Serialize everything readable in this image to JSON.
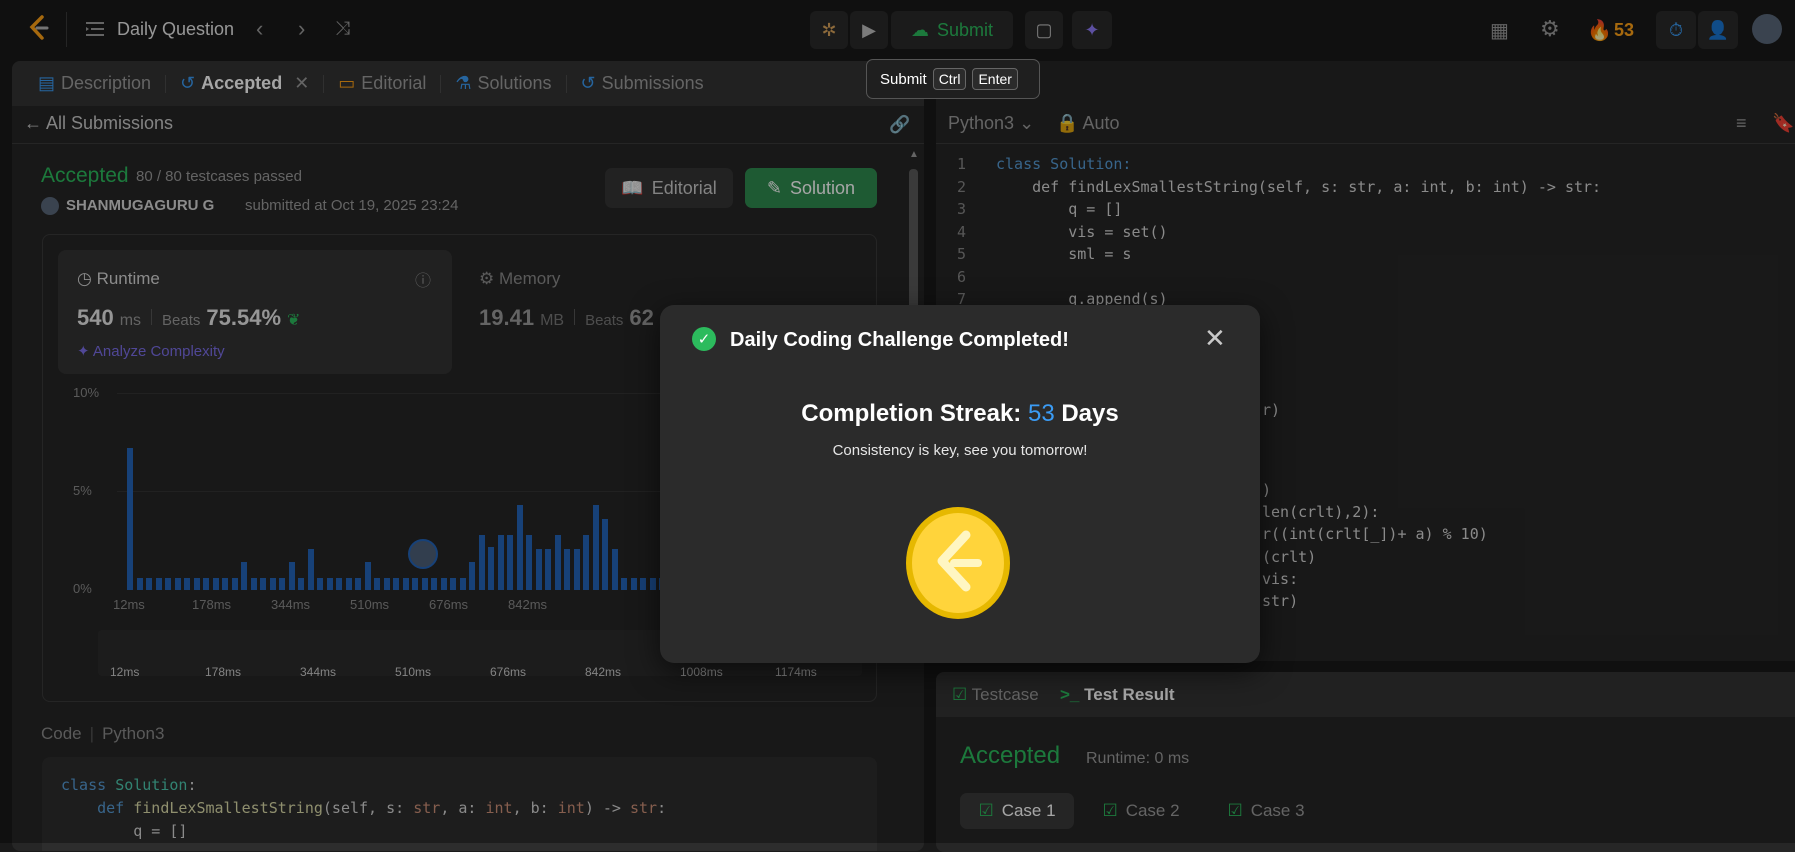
{
  "topbar": {
    "title": "Daily Question",
    "submit_label": "Submit",
    "streak_count": "53"
  },
  "tooltip": {
    "label": "Submit",
    "key1": "Ctrl",
    "key2": "Enter"
  },
  "left_tabs": [
    {
      "label": "Description"
    },
    {
      "label": "Accepted"
    },
    {
      "label": "Editorial"
    },
    {
      "label": "Solutions"
    },
    {
      "label": "Submissions"
    }
  ],
  "submission": {
    "back_label": "All Submissions",
    "status": "Accepted",
    "testcases": "80 / 80 testcases passed",
    "user": "SHANMUGAGURU G",
    "submitted_text": "submitted at Oct 19, 2025 23:24",
    "editorial_btn": "Editorial",
    "solution_btn": "Solution"
  },
  "runtime": {
    "label": "Runtime",
    "value": "540",
    "unit": "ms",
    "beats_label": "Beats",
    "beats_value": "75.54%",
    "analyze": "Analyze Complexity"
  },
  "memory": {
    "label": "Memory",
    "value": "19.41",
    "unit": "MB",
    "beats_label": "Beats",
    "beats_value": "62"
  },
  "chart_data": {
    "type": "bar",
    "y_ticks": [
      "10%",
      "5%",
      "0%"
    ],
    "x_ticks": [
      "12ms",
      "178ms",
      "344ms",
      "510ms",
      "676ms",
      "842ms"
    ],
    "mini_ticks": [
      "12ms",
      "178ms",
      "344ms",
      "510ms",
      "676ms",
      "842ms",
      "1008ms",
      "1174ms"
    ],
    "ylim": [
      0,
      10
    ],
    "values": [
      7.2,
      0.6,
      0.6,
      0.6,
      0.6,
      0.6,
      0.6,
      0.6,
      0.6,
      0.6,
      0.6,
      0.6,
      1.4,
      0.6,
      0.6,
      0.6,
      0.6,
      1.4,
      0.6,
      2.1,
      0.6,
      0.6,
      0.6,
      0.6,
      0.6,
      1.4,
      0.6,
      0.6,
      0.6,
      0.6,
      0.6,
      0.6,
      0.6,
      0.6,
      0.6,
      0.6,
      1.4,
      2.8,
      2.2,
      2.8,
      2.8,
      4.3,
      2.8,
      2.1,
      2.1,
      2.8,
      2.1,
      2.1,
      2.8,
      4.3,
      3.6,
      2.1,
      0.6,
      0.6,
      0.6,
      0.6,
      0.6,
      0.6
    ]
  },
  "code_section": {
    "label": "Code",
    "lang": "Python3"
  },
  "editor": {
    "lang": "Python3",
    "mode": "Auto"
  },
  "code_lines": [
    "class Solution:",
    "    def findLexSmallestString(self, s: str, a: int, b: int) -> str:",
    "        q = []",
    "        vis = set()",
    "        sml = s",
    "",
    "        q.append(s)"
  ],
  "code_fragments": [
    "r)",
    ")",
    "len(crlt),2):",
    "r((int(crlt[_])+ a) % 10)",
    "(crlt)",
    "vis:",
    "str)"
  ],
  "bottom_code": [
    "class Solution:",
    "    def findLexSmallestString(self, s: str, a: int, b: int) -> str:",
    "        q = []"
  ],
  "test_panel": {
    "tab1": "Testcase",
    "tab2": "Test Result",
    "status": "Accepted",
    "runtime": "Runtime: 0 ms",
    "cases": [
      "Case 1",
      "Case 2",
      "Case 3"
    ]
  },
  "modal": {
    "title": "Daily Coding Challenge Completed!",
    "streak_label": "Completion Streak:",
    "streak_value": "53",
    "streak_unit": "Days",
    "message": "Consistency is key, see you tomorrow!"
  },
  "colors": {
    "accent_green": "#2cbb5d",
    "link_blue": "#3b9cf5",
    "orange": "#ffa116"
  }
}
